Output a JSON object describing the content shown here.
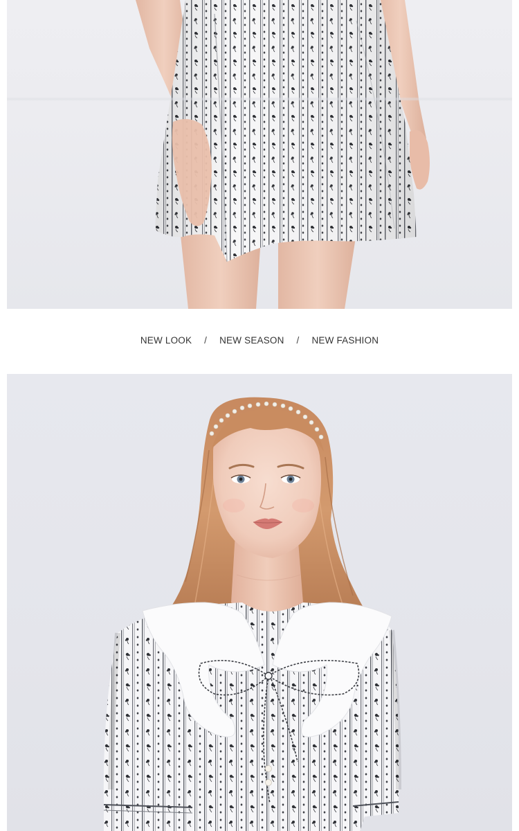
{
  "top_photo": {
    "alt": "",
    "subject": "lower half of model wearing striped floral-print dress"
  },
  "slogan": {
    "items": [
      "NEW LOOK",
      "NEW SEASON",
      "NEW FASHION"
    ],
    "separator": "/"
  },
  "bottom_photo": {
    "alt": "",
    "subject": "model wearing pearl headband and striped floral-print blouse with white collar and bow"
  },
  "colors": {
    "background": "#ffffff",
    "photo_backdrop": "#e6e7ec",
    "fabric_white": "#f7f7f8",
    "fabric_stripe": "#5d6068",
    "text": "#333333"
  }
}
